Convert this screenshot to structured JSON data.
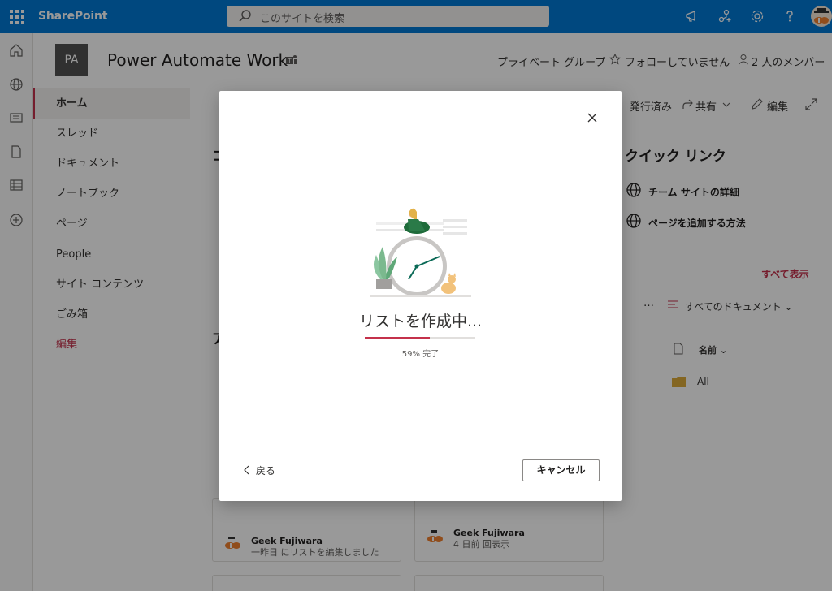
{
  "suite_bar": {
    "app_name": "SharePoint",
    "search_placeholder": "このサイトを検索"
  },
  "site": {
    "logo_text": "PA",
    "title": "Power Automate Work",
    "privacy": "プライベート グループ",
    "follow": "フォローしていません",
    "members": "2 人のメンバー"
  },
  "nav": {
    "items": [
      "ホーム",
      "スレッド",
      "ドキュメント",
      "ノートブック",
      "ページ",
      "People",
      "サイト コンテンツ",
      "ごみ箱"
    ],
    "edit": "編集"
  },
  "command_bar": {
    "published": "発行済み",
    "share": "共有",
    "edit": "編集"
  },
  "quick_links": {
    "title": "クイック リンク",
    "items": [
      "チーム サイトの詳細",
      "ページを追加する方法"
    ]
  },
  "documents": {
    "see_all": "すべて表示",
    "more": "…",
    "view": "すべてのドキュメント",
    "name_header": "名前",
    "folder": "All"
  },
  "activity_cards": [
    {
      "user": "Geek Fujiwara",
      "detail": "一昨日 にリストを編集しました"
    },
    {
      "user": "Geek Fujiwara",
      "detail": "4 日前 回表示"
    }
  ],
  "dialog": {
    "status": "リストを作成中...",
    "progress_percent": 59,
    "progress_text": "59% 完了",
    "back_label": "戻る",
    "cancel_label": "キャンセル"
  },
  "colors": {
    "suite_bar": "#0078d4",
    "accent": "#c4314b"
  }
}
